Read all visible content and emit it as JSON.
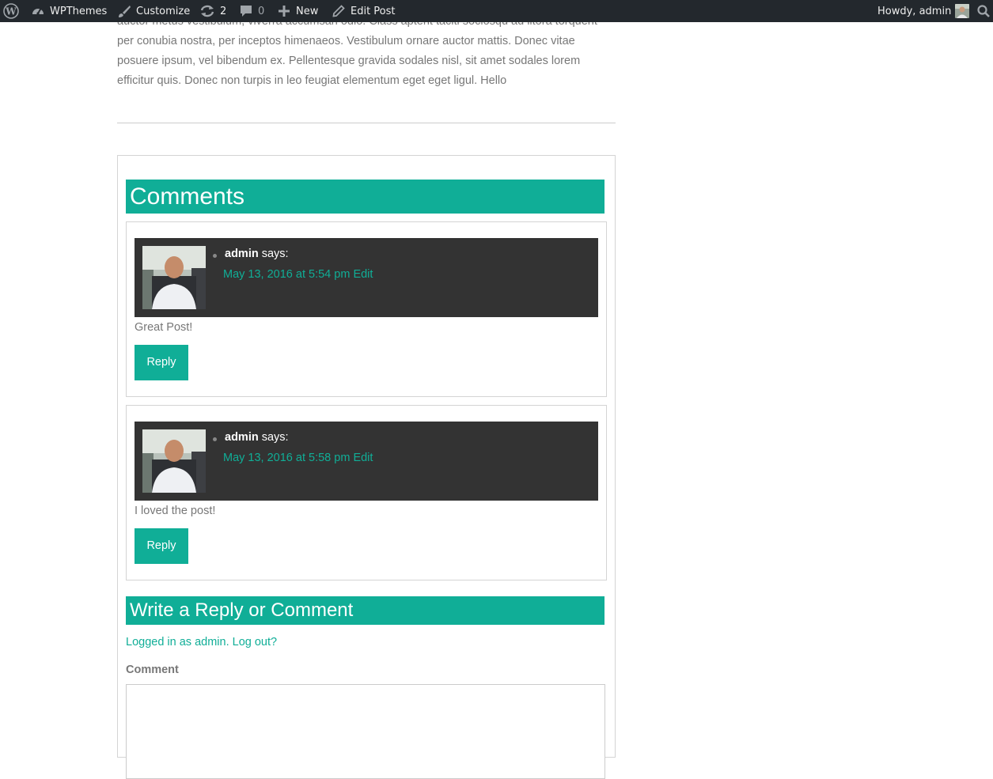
{
  "admin_bar": {
    "site_name": "WPThemes",
    "customize": "Customize",
    "updates_count": "2",
    "comments_count": "0",
    "new_label": "New",
    "edit_post": "Edit Post",
    "howdy": "Howdy, admin",
    "icons": [
      "wordpress-logo-icon",
      "dashboard-icon",
      "brush-icon",
      "updates-icon",
      "comment-bubble-icon",
      "plus-icon",
      "pencil-icon",
      "search-icon"
    ],
    "bg_color": "#23282d"
  },
  "post": {
    "lines": [
      "auctor metus vestibulum, viverra accumsan odio. Class aptent taciti sociosqu ad litora torquent",
      "per conubia nostra, per inceptos himenaeos. Vestibulum ornare auctor mattis. Donec vitae",
      "posuere ipsum, vel bibendum ex. Pellentesque gravida sodales nisl, sit amet sodales lorem",
      "efficitur quis. Donec non turpis in leo feugiat elementum eget eget ligul. Hello"
    ]
  },
  "comments": {
    "title": "Comments",
    "items": [
      {
        "author": "admin",
        "says": "says:",
        "date": "May 13, 2016 at 5:54 pm",
        "edit": "Edit",
        "text": "Great Post!",
        "reply": "Reply"
      },
      {
        "author": "admin",
        "says": "says:",
        "date": "May 13, 2016 at 5:58 pm",
        "edit": "Edit",
        "text": "I loved the post!",
        "reply": "Reply"
      }
    ]
  },
  "reply_form": {
    "title": "Write a Reply or Comment",
    "logged_in": "Logged in as admin.",
    "log_out": "Log out?",
    "comment_label": "Comment",
    "comment_value": ""
  },
  "colors": {
    "accent": "#10ae97",
    "meta_bg": "#333333",
    "text": "#777777"
  }
}
